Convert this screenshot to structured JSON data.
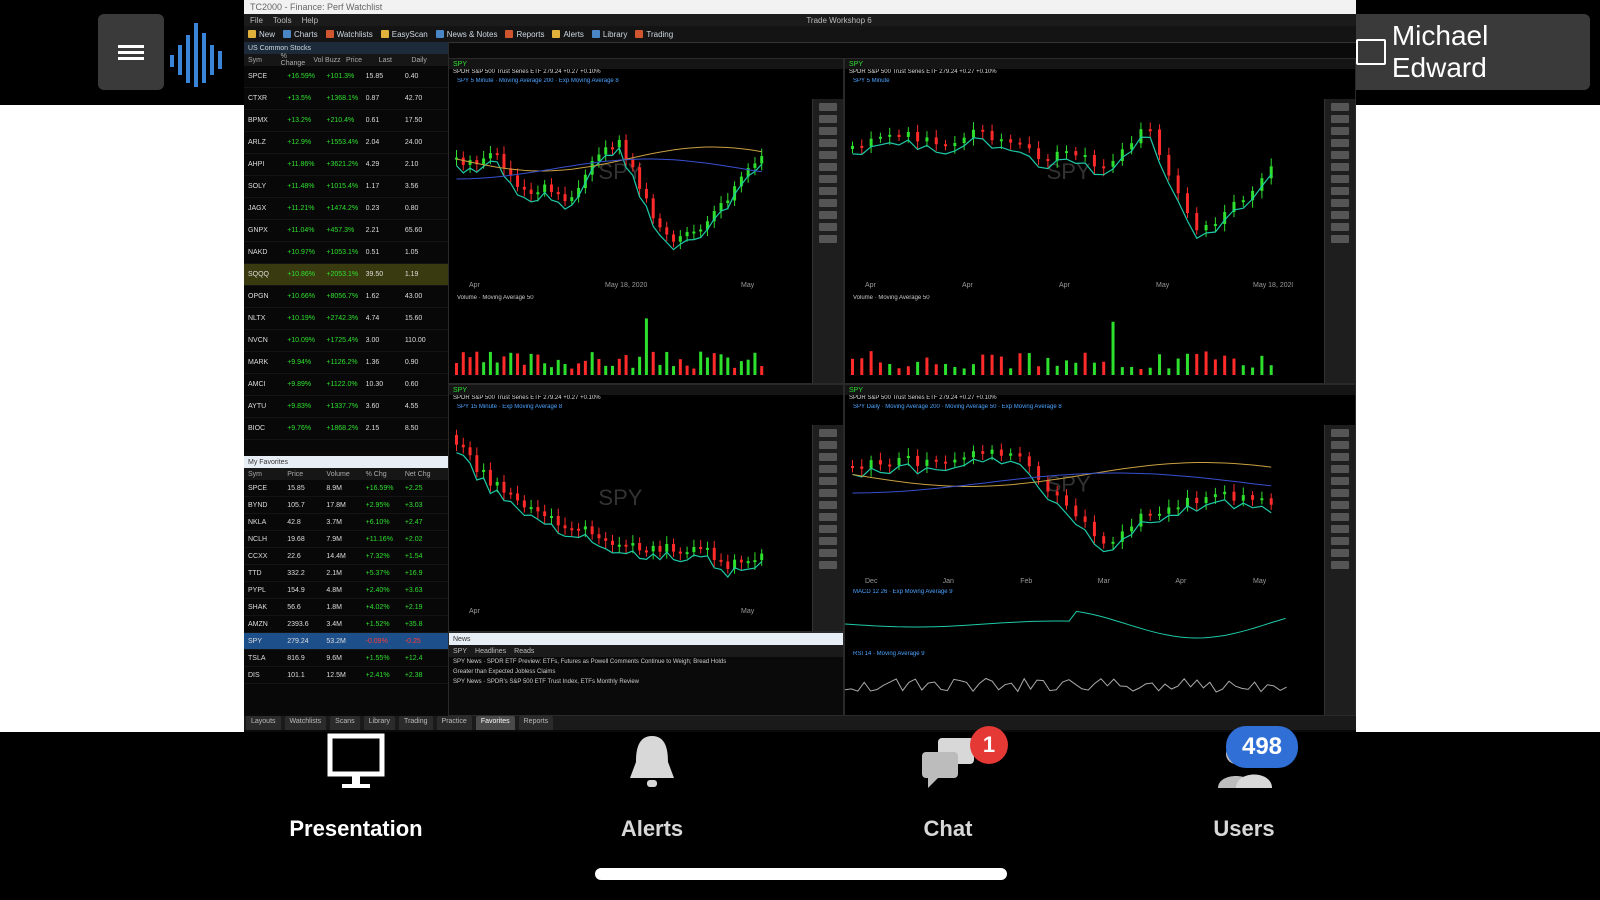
{
  "app": {
    "user_name": "Michael Edward",
    "window_title": "TC2000 - Finance: Perf Watchlist",
    "window_center_title": "Trade Workshop 6"
  },
  "menus": [
    "File",
    "Tools",
    "Help"
  ],
  "toolbar": [
    "New",
    "Charts",
    "Watchlists",
    "EasyScan",
    "News & Notes",
    "Reports",
    "Alerts",
    "Library",
    "Trading"
  ],
  "watchlist": {
    "title": "US Common Stocks",
    "columns": [
      "Sym",
      "% Change",
      "Vol Buzz",
      "Price",
      "Last",
      "Daily"
    ],
    "rows": [
      {
        "sym": "SPCE",
        "chg": "+16.59%",
        "buzz": "+101.3%",
        "price": "15.85",
        "last": "0.40",
        "hl": false
      },
      {
        "sym": "CTXR",
        "chg": "+13.5%",
        "buzz": "+1368.1%",
        "price": "0.87",
        "last": "42.70",
        "hl": false
      },
      {
        "sym": "BPMX",
        "chg": "+13.2%",
        "buzz": "+210.4%",
        "price": "0.61",
        "last": "17.50",
        "hl": false
      },
      {
        "sym": "ARLZ",
        "chg": "+12.9%",
        "buzz": "+1553.4%",
        "price": "2.04",
        "last": "24.00",
        "hl": false
      },
      {
        "sym": "AHPI",
        "chg": "+11.86%",
        "buzz": "+3621.2%",
        "price": "4.29",
        "last": "2.10",
        "hl": false
      },
      {
        "sym": "SOLY",
        "chg": "+11.48%",
        "buzz": "+1015.4%",
        "price": "1.17",
        "last": "3.56",
        "hl": false
      },
      {
        "sym": "JAGX",
        "chg": "+11.21%",
        "buzz": "+1474.2%",
        "price": "0.23",
        "last": "0.80",
        "hl": false
      },
      {
        "sym": "GNPX",
        "chg": "+11.04%",
        "buzz": "+457.3%",
        "price": "2.21",
        "last": "65.60",
        "hl": false
      },
      {
        "sym": "NAKD",
        "chg": "+10.97%",
        "buzz": "+1053.1%",
        "price": "0.51",
        "last": "1.05",
        "hl": false
      },
      {
        "sym": "SQQQ",
        "chg": "+10.86%",
        "buzz": "+2053.1%",
        "price": "39.50",
        "last": "1.19",
        "hl": true
      },
      {
        "sym": "OPGN",
        "chg": "+10.66%",
        "buzz": "+8056.7%",
        "price": "1.62",
        "last": "43.00",
        "hl": false
      },
      {
        "sym": "NLTX",
        "chg": "+10.19%",
        "buzz": "+2742.3%",
        "price": "4.74",
        "last": "15.60",
        "hl": false
      },
      {
        "sym": "NVCN",
        "chg": "+10.09%",
        "buzz": "+1725.4%",
        "price": "3.00",
        "last": "110.00",
        "hl": false
      },
      {
        "sym": "MARK",
        "chg": "+9.94%",
        "buzz": "+1126.2%",
        "price": "1.36",
        "last": "0.90",
        "hl": false
      },
      {
        "sym": "AMCI",
        "chg": "+9.89%",
        "buzz": "+1122.0%",
        "price": "10.30",
        "last": "0.60",
        "hl": false
      },
      {
        "sym": "AYTU",
        "chg": "+9.83%",
        "buzz": "+1337.7%",
        "price": "3.60",
        "last": "4.55",
        "hl": false
      },
      {
        "sym": "BIOC",
        "chg": "+9.76%",
        "buzz": "+1868.2%",
        "price": "2.15",
        "last": "8.50",
        "hl": false
      }
    ]
  },
  "favorites": {
    "title": "My Favorites",
    "columns": [
      "Sym",
      "Price",
      "Volume",
      "% Chg",
      "Net Chg"
    ],
    "rows": [
      {
        "sym": "SPCE",
        "price": "15.85",
        "vol": "8.9M",
        "chg": "+16.59%",
        "net": "+2.25",
        "up": true,
        "sel": false
      },
      {
        "sym": "BYND",
        "price": "105.7",
        "vol": "17.8M",
        "chg": "+2.95%",
        "net": "+3.03",
        "up": true,
        "sel": false
      },
      {
        "sym": "NKLA",
        "price": "42.8",
        "vol": "3.7M",
        "chg": "+6.10%",
        "net": "+2.47",
        "up": true,
        "sel": false
      },
      {
        "sym": "NCLH",
        "price": "19.68",
        "vol": "7.9M",
        "chg": "+11.16%",
        "net": "+2.02",
        "up": true,
        "sel": false
      },
      {
        "sym": "CCXX",
        "price": "22.6",
        "vol": "14.4M",
        "chg": "+7.32%",
        "net": "+1.54",
        "up": true,
        "sel": false
      },
      {
        "sym": "TTD",
        "price": "332.2",
        "vol": "2.1M",
        "chg": "+5.37%",
        "net": "+16.9",
        "up": true,
        "sel": false
      },
      {
        "sym": "PYPL",
        "price": "154.9",
        "vol": "4.8M",
        "chg": "+2.40%",
        "net": "+3.63",
        "up": true,
        "sel": false
      },
      {
        "sym": "SHAK",
        "price": "56.6",
        "vol": "1.8M",
        "chg": "+4.02%",
        "net": "+2.19",
        "up": true,
        "sel": false
      },
      {
        "sym": "AMZN",
        "price": "2393.6",
        "vol": "3.4M",
        "chg": "+1.52%",
        "net": "+35.8",
        "up": true,
        "sel": false
      },
      {
        "sym": "SPY",
        "price": "279.24",
        "vol": "53.2M",
        "chg": "-0.09%",
        "net": "-0.25",
        "up": false,
        "sel": true
      },
      {
        "sym": "TSLA",
        "price": "816.9",
        "vol": "9.6M",
        "chg": "+1.55%",
        "net": "+12.4",
        "up": true,
        "sel": false
      },
      {
        "sym": "DIS",
        "price": "101.1",
        "vol": "12.5M",
        "chg": "+2.41%",
        "net": "+2.38",
        "up": true,
        "sel": false
      }
    ]
  },
  "charts": [
    {
      "sym": "SPY",
      "title": "SPDR S&P 500 Trust Series ETF 279.24 +0.27 +0.10%",
      "legend": "SPY 5 Minute · Moving Average 200 · Exp Moving Average 8",
      "watermark": "SPY",
      "vol_legend": "Volume · Moving Average 50",
      "xticks": [
        "Apr",
        "May 18, 2020",
        "May"
      ]
    },
    {
      "sym": "SPY",
      "title": "SPDR S&P 500 Trust Series ETF 279.24 +0.27 +0.10%",
      "legend": "SPY 5 Minute",
      "watermark": "SPY",
      "vol_legend": "Volume · Moving Average 50",
      "xticks": [
        "Apr",
        "Apr",
        "Apr",
        "May",
        "May 18, 2020"
      ]
    },
    {
      "sym": "SPY",
      "title": "SPDR S&P 500 Trust Series ETF 279.24 +0.27 +0.10%",
      "legend": "SPY 15 Minute · Exp Moving Average 8",
      "watermark": "SPY",
      "xticks": [
        "Apr",
        "May"
      ]
    },
    {
      "sym": "SPY",
      "title": "SPDR S&P 500 Trust Series ETF 279.24 +0.27 +0.10%",
      "legend": "SPY Daily · Moving Average 200 · Moving Average 50 · Exp Moving Average 8",
      "watermark": "SPY",
      "macd_legend": "MACD 12 26 · Exp Moving Average 9",
      "rsi_legend": "RSI 14 · Moving Average 9",
      "xticks": [
        "Dec",
        "Jan",
        "Feb",
        "Mar",
        "Apr",
        "May"
      ]
    }
  ],
  "news": {
    "title": "News",
    "bar_items": [
      "SPY",
      "Headlines",
      "Reads"
    ],
    "rows": [
      "SPY News · SPDR ETF Preview: ETFs, Futures as Powell Comments Continue to Weigh; Bread Holds",
      "Greater than Expected Jobless Claims",
      "SPY News · SPDR's S&P 500 ETF Trust Index, ETFs Monthly Review"
    ]
  },
  "bottom_tabs": [
    "Layouts",
    "Watchlists",
    "Scans",
    "Library",
    "Trading",
    "Practice",
    "Favorites",
    "Reports"
  ],
  "nav": {
    "presentation": "Presentation",
    "alerts": "Alerts",
    "chat": "Chat",
    "chat_badge": "1",
    "users": "Users",
    "users_badge": "498"
  },
  "colors": {
    "up": "#2ee02e",
    "down": "#ff2a2a",
    "accent": "#4a86c5",
    "badge_red": "#e53935",
    "badge_blue": "#2f6fd6"
  }
}
